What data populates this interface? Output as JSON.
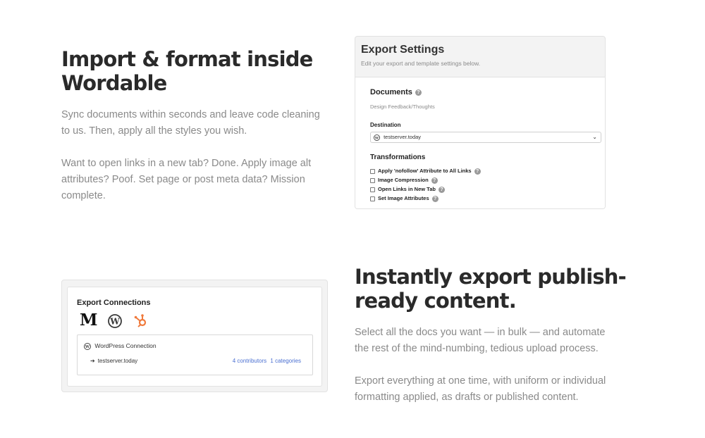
{
  "section1": {
    "heading_line1": "Import & format inside",
    "heading_line2": "Wordable",
    "para1": "Sync documents within seconds and leave code cleaning to us. Then, apply all the styles you wish.",
    "para2": "Want to open links in a new tab? Done. Apply image alt attributes? Poof. Set page or post meta data? Mission complete."
  },
  "export_settings": {
    "title": "Export Settings",
    "subtitle": "Edit your export and template settings below.",
    "documents_label": "Documents",
    "document_name": "Design Feedback/Thoughts",
    "destination_label": "Destination",
    "destination_value": "testserver.today",
    "transformations_label": "Transformations",
    "options": [
      {
        "label": "Apply 'nofollow' Attribute to All Links",
        "checked": false
      },
      {
        "label": "Image Compression",
        "checked": false
      },
      {
        "label": "Open Links in New Tab",
        "checked": false
      },
      {
        "label": "Set Image Attributes",
        "checked": false
      }
    ]
  },
  "export_connections": {
    "title": "Export Connections",
    "logos": [
      "medium-logo-icon",
      "wordpress-logo-icon",
      "hubspot-logo-icon"
    ],
    "connection_name": "WordPress Connection",
    "server": "testserver.today",
    "contributors": "4 contributors",
    "categories": "1 categories"
  },
  "section2": {
    "heading_line1": "Instantly export publish-",
    "heading_line2": "ready content.",
    "para1": "Select all the docs you want — in bulk — and automate the rest of the mind-numbing, tedious upload process.",
    "para2": "Export everything at one time, with uniform or individual formatting applied, as drafts or published content."
  },
  "colors": {
    "heading": "#2a2a2a",
    "body_text": "#8a8a8a",
    "link": "#4a6fd1",
    "hubspot": "#f07a3c"
  }
}
